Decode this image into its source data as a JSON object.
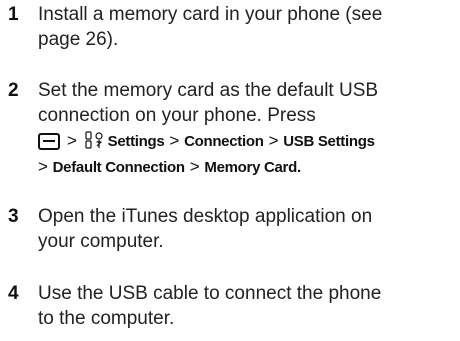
{
  "steps": [
    {
      "number": "1",
      "lines": [
        "Install a memory card in your phone (see",
        "page 26)."
      ]
    },
    {
      "number": "2",
      "lines": [
        "Set the memory card as the default USB",
        "connection on your phone. Press"
      ],
      "command": {
        "menu_key_icon": "menu-key-icon",
        "settings_icon": "settings-icon",
        "separator": ">",
        "path_line1": [
          "Settings",
          "Connection",
          "USB Settings"
        ],
        "path_line2": [
          "Default Connection",
          "Memory Card"
        ],
        "end": "."
      }
    },
    {
      "number": "3",
      "lines": [
        "Open the iTunes desktop application on",
        "your computer."
      ]
    },
    {
      "number": "4",
      "lines": [
        "Use the USB cable to connect the phone",
        "to the computer."
      ]
    }
  ]
}
